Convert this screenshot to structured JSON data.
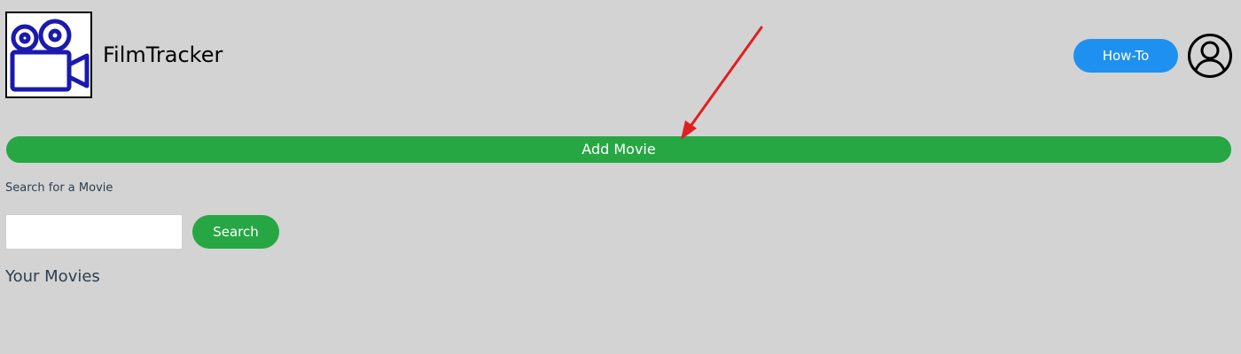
{
  "header": {
    "app_title": "FilmTracker",
    "logo_icon": "movie-camera-icon",
    "howto_label": "How-To",
    "account_icon": "user-account-icon"
  },
  "main": {
    "add_movie_label": "Add Movie",
    "search_label": "Search for a Movie",
    "search_input_value": "",
    "search_button_label": "Search",
    "movies_section_title": "Your Movies"
  },
  "colors": {
    "background": "#d3d3d3",
    "primary_green": "#27a744",
    "howto_blue": "#1e90f0",
    "logo_blue": "#1a1aad",
    "annotation_red": "#e02020"
  }
}
